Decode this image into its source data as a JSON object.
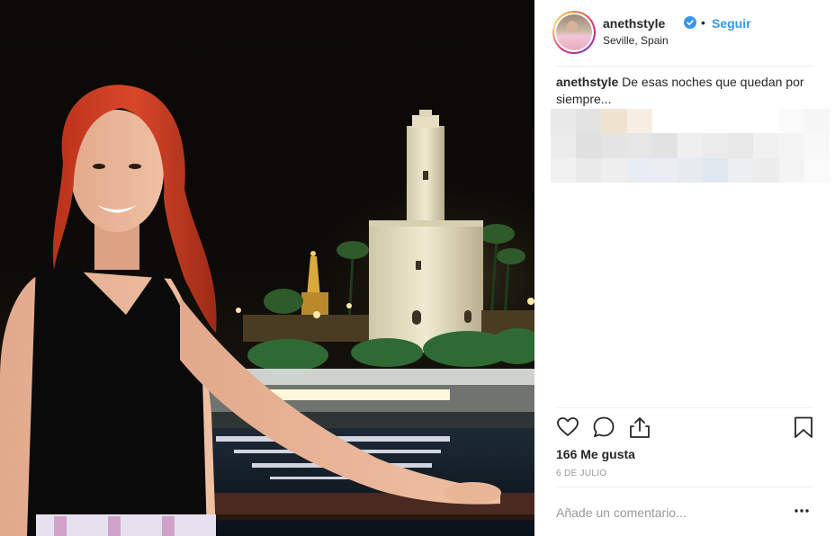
{
  "post": {
    "username": "anethstyle",
    "follow_label": "Seguir",
    "separator": "•",
    "location": "Seville, Spain",
    "caption_user": "anethstyle",
    "caption_text": " De esas noches que quedan por siempre...",
    "likes": "166 Me gusta",
    "date": "6 DE JULIO",
    "comment_placeholder": "Añade un comentario..."
  },
  "icons": {
    "like": "heart-icon",
    "comment": "comment-icon",
    "share": "share-icon",
    "save": "bookmark-icon",
    "more": "more-options-icon",
    "verified": "verified-badge-icon"
  },
  "colors": {
    "accent": "#3897f0",
    "text": "#262626",
    "muted": "#999999",
    "divider": "#efefef"
  }
}
